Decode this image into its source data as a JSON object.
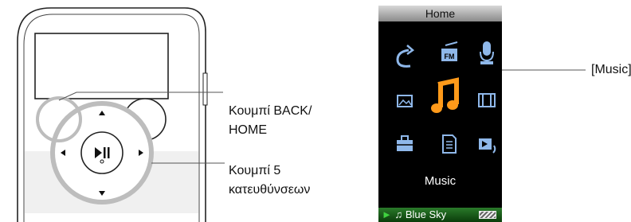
{
  "device": {
    "back_home_label_line1": "Κουμπί BACK/",
    "back_home_label_line2": "HOME",
    "five_way_label_line1": "Κουμπί 5",
    "five_way_label_line2": "κατευθύνσεων"
  },
  "home_screen": {
    "title": "Home",
    "selected_label": "Music",
    "callout_label": "[Music]",
    "icons": [
      "playback-mode-icon",
      "fm-radio-icon",
      "microphone-icon",
      "photo-icon",
      "music-note-icon",
      "video-icon",
      "settings-briefcase-icon",
      "document-icon",
      "slideshow-icon"
    ],
    "now_playing": "Blue Sky"
  },
  "colors": {
    "icon_blue": "#8fb8ea",
    "highlight_orange": "#ff9a1a",
    "status_green": "#2a7a2a"
  }
}
